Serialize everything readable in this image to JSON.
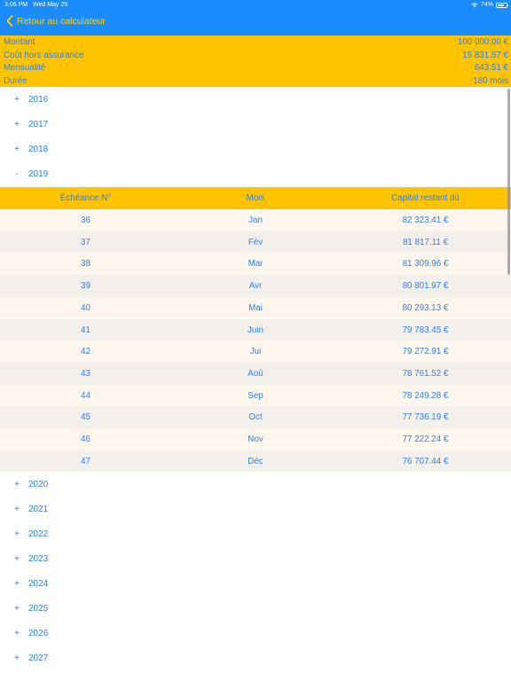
{
  "status": {
    "time": "3:06 PM",
    "date": "Wed May 29",
    "battery": "74%",
    "battery_level": 0.74
  },
  "nav": {
    "back_label": "Retour au calculateur"
  },
  "summary": [
    {
      "label": "Montant",
      "value": "100 000.00 €"
    },
    {
      "label": "Coût hors assurance",
      "value": "15 831.57 €"
    },
    {
      "label": "Mensualité",
      "value": "643.51 €"
    },
    {
      "label": "Durée",
      "value": "180 mois"
    }
  ],
  "years_before": [
    {
      "sign": "+",
      "label": "2016"
    },
    {
      "sign": "+",
      "label": "2017"
    },
    {
      "sign": "+",
      "label": "2018"
    },
    {
      "sign": "-",
      "label": "2019"
    }
  ],
  "table": {
    "headers": {
      "col1": "Échéance N°",
      "col2": "Mois",
      "col3": "Capital restant dû"
    },
    "rows": [
      {
        "n": "36",
        "month": "Jan",
        "capital": "82 323.41 €"
      },
      {
        "n": "37",
        "month": "Fév",
        "capital": "81 817.11 €"
      },
      {
        "n": "38",
        "month": "Mar",
        "capital": "81 309.96 €"
      },
      {
        "n": "39",
        "month": "Avr",
        "capital": "80 801.97 €"
      },
      {
        "n": "40",
        "month": "Mai",
        "capital": "80 293.13 €"
      },
      {
        "n": "41",
        "month": "Juin",
        "capital": "79 783.45 €"
      },
      {
        "n": "42",
        "month": "Jui",
        "capital": "79 272.91 €"
      },
      {
        "n": "43",
        "month": "Aoû",
        "capital": "78 761.52 €"
      },
      {
        "n": "44",
        "month": "Sep",
        "capital": "78 249.28 €"
      },
      {
        "n": "45",
        "month": "Oct",
        "capital": "77 736.19 €"
      },
      {
        "n": "46",
        "month": "Nov",
        "capital": "77 222.24 €"
      },
      {
        "n": "47",
        "month": "Déc",
        "capital": "76 707.44 €"
      }
    ]
  },
  "years_after": [
    {
      "sign": "+",
      "label": "2020"
    },
    {
      "sign": "+",
      "label": "2021"
    },
    {
      "sign": "+",
      "label": "2022"
    },
    {
      "sign": "+",
      "label": "2023"
    },
    {
      "sign": "+",
      "label": "2024"
    },
    {
      "sign": "+",
      "label": "2025"
    },
    {
      "sign": "+",
      "label": "2026"
    },
    {
      "sign": "+",
      "label": "2027"
    }
  ],
  "colors": {
    "nav_blue": "#1a8cff",
    "accent_yellow": "#ffc400",
    "text_blue": "#2f7ff0"
  }
}
